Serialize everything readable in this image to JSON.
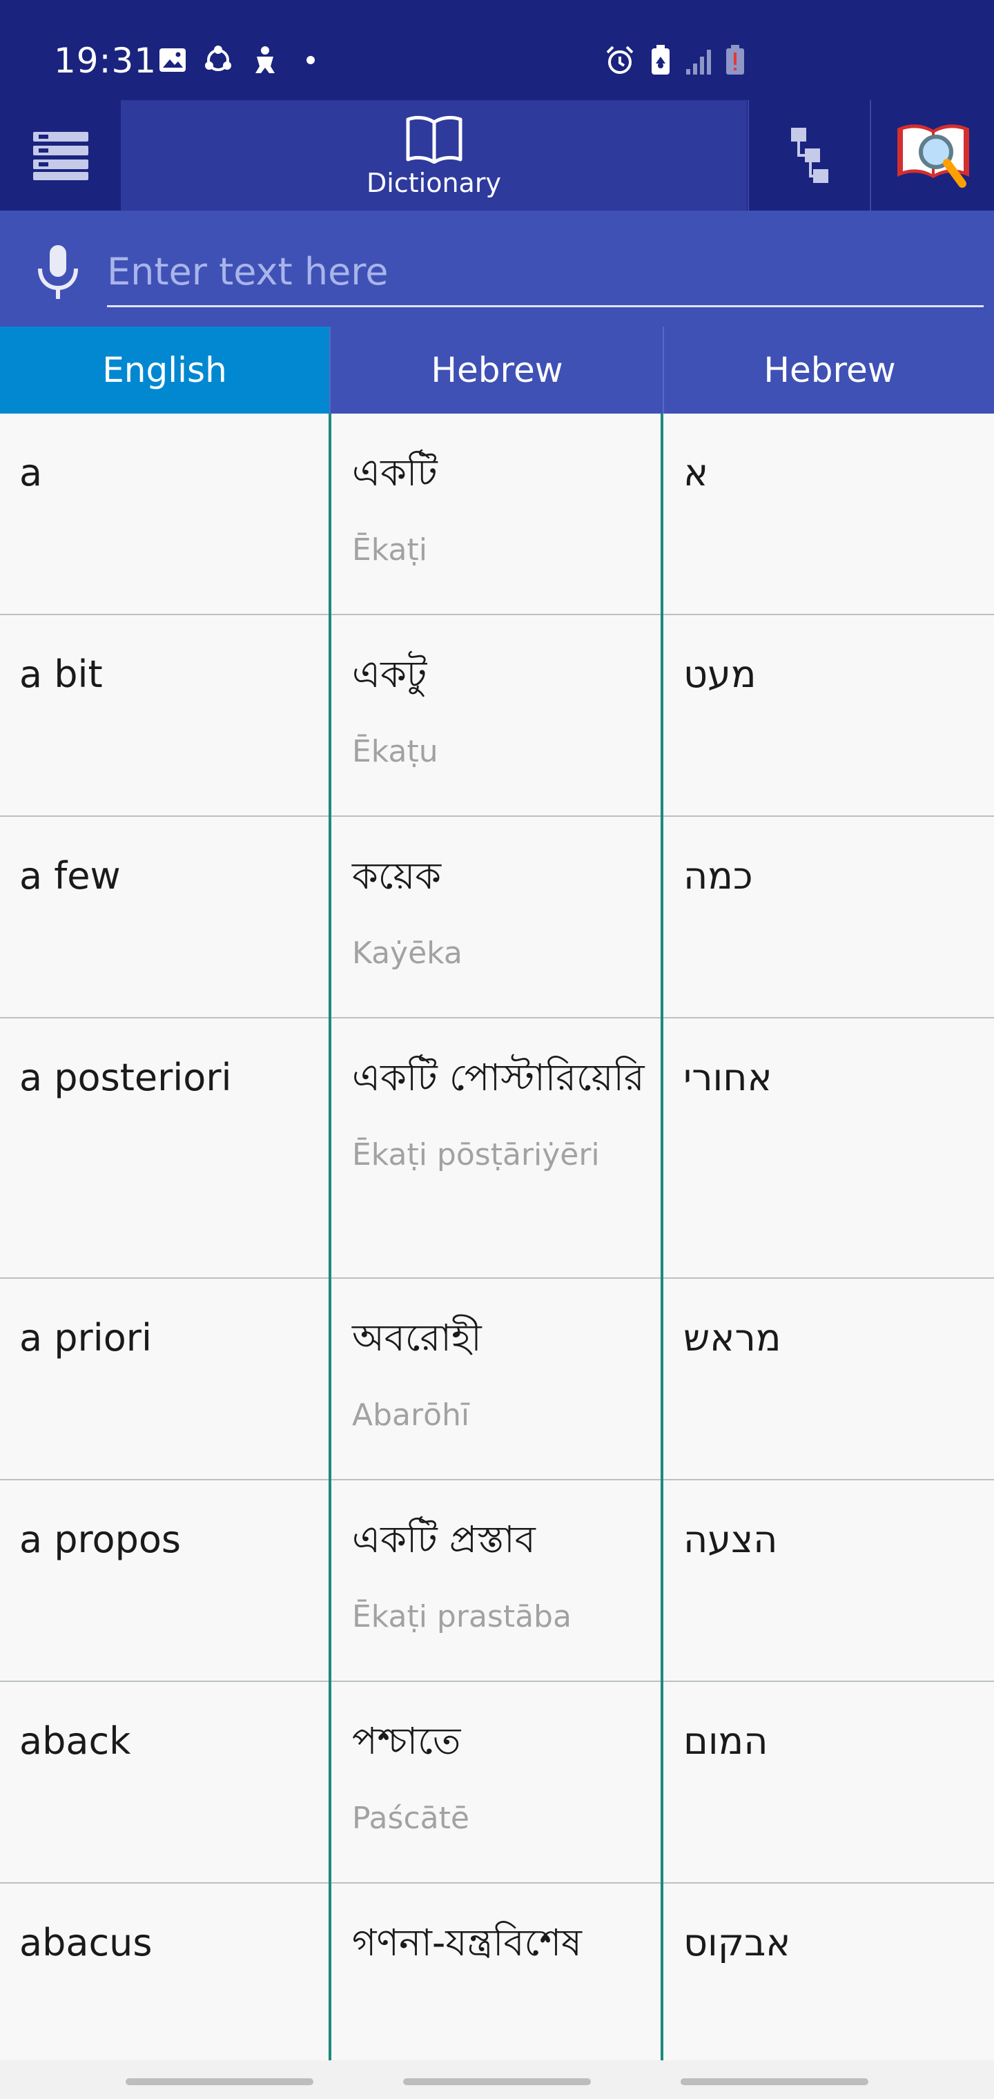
{
  "status_bar": {
    "time": "19:31",
    "left_icons": [
      "gallery-icon",
      "sync-icon",
      "android-debug-icon",
      "dot-icon"
    ],
    "right_icons": [
      "alarm-icon",
      "battery-saver-icon",
      "signal-icon",
      "battery-low-icon"
    ]
  },
  "toolbar": {
    "menu_icon": "menu-icon",
    "dictionary_label": "Dictionary",
    "dictionary_icon": "book-icon",
    "tree_icon": "tree-view-icon",
    "search_icon": "magnifier-book-icon"
  },
  "search": {
    "placeholder": "Enter text here",
    "value": ""
  },
  "columns": {
    "col1": "English",
    "col2": "Hebrew",
    "col3": "Hebrew"
  },
  "rows": [
    {
      "term": "a",
      "bengali": "একটি",
      "translit": "Ēkaṭi",
      "hebrew": "א"
    },
    {
      "term": "a bit",
      "bengali": "একটু",
      "translit": "Ēkaṭu",
      "hebrew": "מעט"
    },
    {
      "term": "a few",
      "bengali": "কয়েক",
      "translit": "Kaẏēka",
      "hebrew": "כמה"
    },
    {
      "term": "a posteriori",
      "bengali": "একটি পোস্টারিয়েরি",
      "translit": "Ēkaṭi pōsṭāriẏēri",
      "hebrew": "אחורי"
    },
    {
      "term": "a priori",
      "bengali": "অবরোহী",
      "translit": "Abarōhī",
      "hebrew": "מראש"
    },
    {
      "term": "a propos",
      "bengali": "একটি প্রস্তাব",
      "translit": "Ēkaṭi prastāba",
      "hebrew": "הצעה"
    },
    {
      "term": "aback",
      "bengali": "পশ্চাতে",
      "translit": "Paścātē",
      "hebrew": "המום"
    },
    {
      "term": "abacus",
      "bengali": "গণনা-যন্ত্রবিশেষ",
      "translit": "",
      "hebrew": "אבקוס"
    }
  ],
  "colors": {
    "primary_dark": "#1a237e",
    "primary": "#3f51b5",
    "active_tab": "#0288d1",
    "divider": "#1b8a80"
  }
}
